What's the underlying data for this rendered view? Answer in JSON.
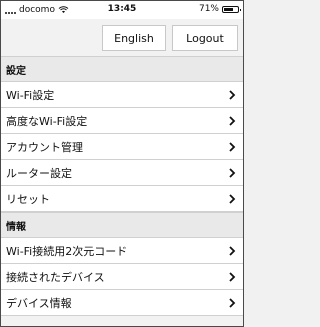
{
  "status_bar": {
    "carrier": "docomo",
    "time": "13:45",
    "battery_percent": "71%",
    "battery_level": 0.71
  },
  "top_bar": {
    "english_label": "English",
    "logout_label": "Logout"
  },
  "sections": {
    "settings": {
      "title": "設定",
      "items": [
        {
          "label": "Wi-Fi設定"
        },
        {
          "label": "高度なWi-Fi設定"
        },
        {
          "label": "アカウント管理"
        },
        {
          "label": "ルーター設定"
        },
        {
          "label": "リセット"
        }
      ]
    },
    "info": {
      "title": "情報",
      "items": [
        {
          "label": "Wi-Fi接続用2次元コード"
        },
        {
          "label": "接続されたデバイス"
        },
        {
          "label": "デバイス情報"
        }
      ]
    }
  },
  "icons": {
    "chevron": "chevron-right-icon",
    "wifi": "wifi-icon",
    "battery": "battery-icon",
    "signal": "signal-icon"
  }
}
